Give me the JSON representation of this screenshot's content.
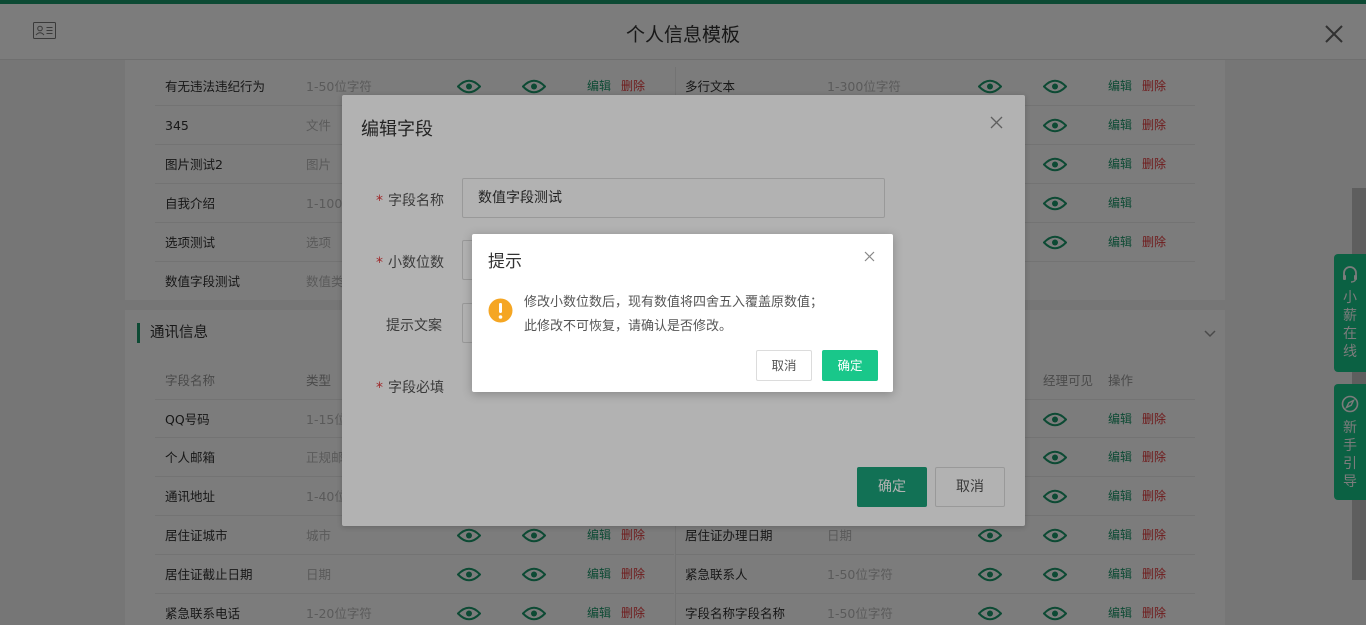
{
  "header": {
    "title": "个人信息模板",
    "icon": "id-card-icon",
    "close_icon": "close-icon"
  },
  "actions": {
    "edit": "编辑",
    "delete": "删除"
  },
  "colors": {
    "accent": "#1d9a6c",
    "button_green": "#19c78a",
    "delete_red": "#e4393c",
    "warning": "#f5a623"
  },
  "top_section": {
    "rows": [
      {
        "left": {
          "name": "有无违法违纪行为",
          "type": "1-50位字符"
        },
        "right": {
          "name": "多行文本",
          "type": "1-300位字符"
        }
      },
      {
        "left": {
          "name": "345",
          "type": "文件"
        }
      },
      {
        "left": {
          "name": "图片测试2",
          "type": "图片"
        }
      },
      {
        "left": {
          "name": "自我介绍",
          "type": "1-1000"
        }
      },
      {
        "left": {
          "name": "选项测试",
          "type": "选项"
        }
      },
      {
        "left": {
          "name": "数值字段测试",
          "type": "数值类"
        }
      }
    ]
  },
  "comm_section": {
    "title": "通讯信息",
    "headers": {
      "field_name": "字段名称",
      "type": "类型",
      "manager_visible": "经理可见",
      "operation": "操作"
    },
    "rows": [
      {
        "left": {
          "name": "QQ号码",
          "type": "1-15位"
        }
      },
      {
        "left": {
          "name": "个人邮箱",
          "type": "正规邮"
        }
      },
      {
        "left": {
          "name": "通讯地址",
          "type": "1-40位"
        }
      },
      {
        "left": {
          "name": "居住证城市",
          "type": "城市"
        },
        "right": {
          "name": "居住证办理日期",
          "type": "日期"
        }
      },
      {
        "left": {
          "name": "居住证截止日期",
          "type": "日期"
        },
        "right": {
          "name": "紧急联系人",
          "type": "1-50位字符"
        }
      },
      {
        "left": {
          "name": "紧急联系电话",
          "type": "1-20位字符"
        },
        "right": {
          "name": "字段名称字段名称",
          "type": "1-50位字符"
        }
      }
    ]
  },
  "side_buttons": [
    {
      "label": "小薪在线",
      "icon": "headset-icon"
    },
    {
      "label": "新手引导",
      "icon": "compass-icon"
    }
  ],
  "edit_dialog": {
    "title": "编辑字段",
    "labels": {
      "field_name": "字段名称",
      "decimals": "小数位数",
      "hint": "提示文案",
      "required": "字段必填"
    },
    "field_name_value": "数值字段测试",
    "ok": "确定",
    "cancel": "取消"
  },
  "confirm_dialog": {
    "title": "提示",
    "line1": "修改小数位数后，现有数值将四舍五入覆盖原数值；",
    "line2": "此修改不可恢复，请确认是否修改。",
    "cancel": "取消",
    "ok": "确定",
    "icon": "warning-icon"
  }
}
